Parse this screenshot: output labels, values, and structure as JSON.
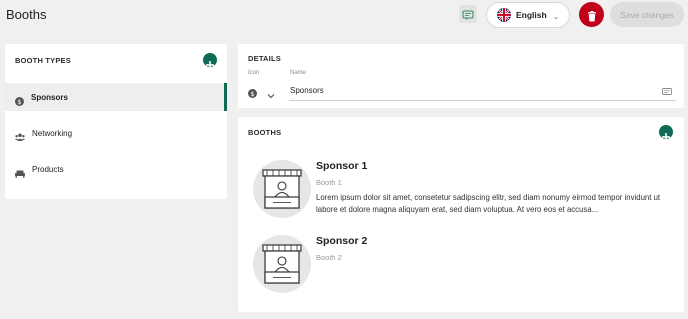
{
  "header": {
    "title": "Booths",
    "language": "English",
    "save_label": "Save changes"
  },
  "booth_types": {
    "title": "BOOTH TYPES",
    "items": [
      {
        "label": "Sponsors",
        "icon": "dollar-circle-icon",
        "active": true
      },
      {
        "label": "Networking",
        "icon": "people-icon",
        "active": false
      },
      {
        "label": "Products",
        "icon": "couch-icon",
        "active": false
      }
    ]
  },
  "details": {
    "title": "DETAILS",
    "icon_label": "Icon",
    "name_label": "Name",
    "name_value": "Sponsors"
  },
  "booths": {
    "title": "BOOTHS",
    "items": [
      {
        "title": "Sponsor 1",
        "subtitle": "Booth 1",
        "description": "Lorem ipsum dolor sit amet, consetetur sadipscing elitr, sed diam nonumy eirmod tempor invidunt ut labore et dolore magna aliquyam erat, sed diam voluptua. At vero eos et accusa..."
      },
      {
        "title": "Sponsor 2",
        "subtitle": "Booth 2",
        "description": ""
      }
    ]
  },
  "colors": {
    "accent": "#0f6b55",
    "danger": "#c0001a",
    "background": "#f0f0f0"
  }
}
